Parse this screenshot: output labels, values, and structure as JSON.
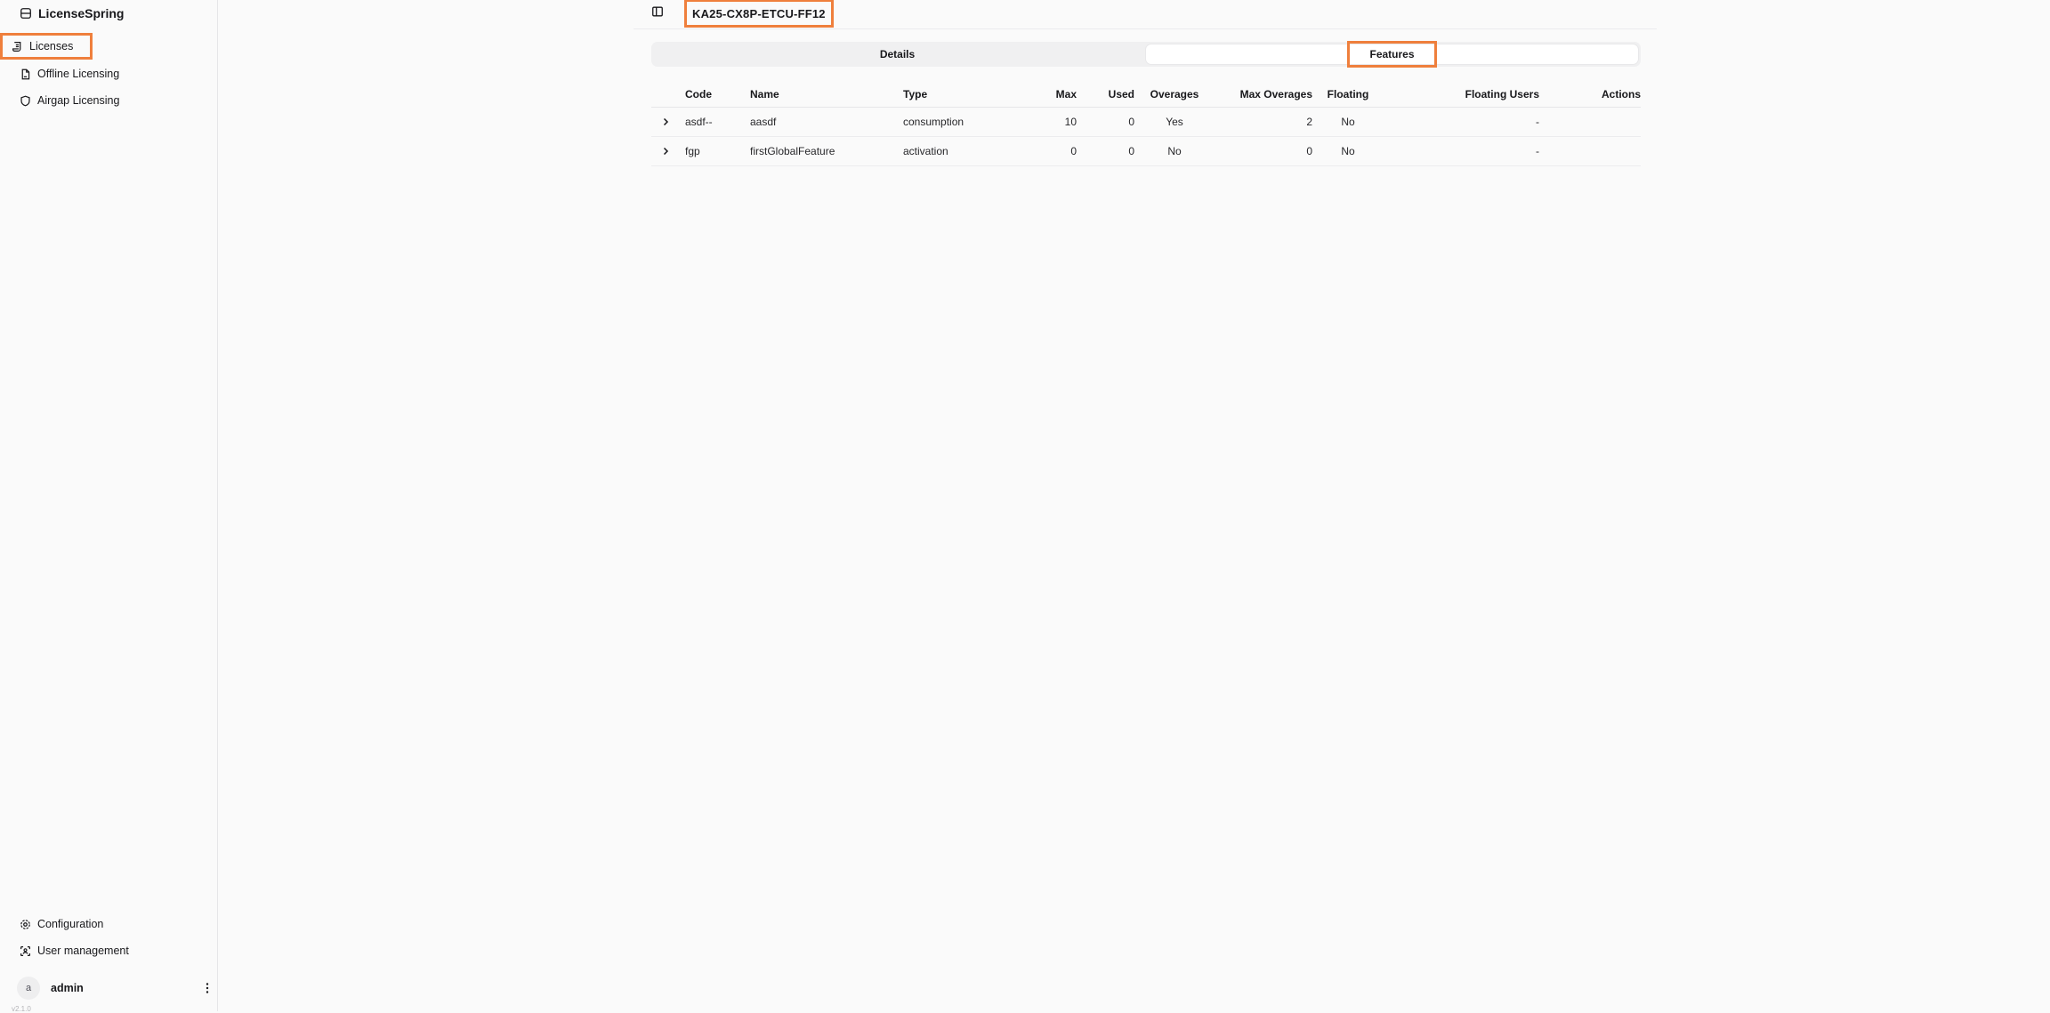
{
  "brand": {
    "name": "LicenseSpring"
  },
  "sidebar": {
    "items": [
      {
        "label": "Licenses"
      },
      {
        "label": "Offline Licensing"
      },
      {
        "label": "Airgap Licensing"
      }
    ],
    "bottom": [
      {
        "label": "Configuration"
      },
      {
        "label": "User management"
      }
    ],
    "user": {
      "avatar": "a",
      "name": "admin"
    },
    "version": "v2.1.0"
  },
  "header": {
    "license_key": "KA25-CX8P-ETCU-FF12"
  },
  "tabs": [
    {
      "label": "Details",
      "active": false
    },
    {
      "label": "Features",
      "active": true
    }
  ],
  "table": {
    "headers": [
      "Code",
      "Name",
      "Type",
      "Max",
      "Used",
      "Overages",
      "Max Overages",
      "Floating",
      "Floating Users",
      "Actions"
    ],
    "rows": [
      {
        "code": "asdf--",
        "name": "aasdf",
        "type": "consumption",
        "max": "10",
        "used": "0",
        "overages": "Yes",
        "max_overages": "2",
        "floating": "No",
        "floating_users": "-",
        "actions": ""
      },
      {
        "code": "fgp",
        "name": "firstGlobalFeature",
        "type": "activation",
        "max": "0",
        "used": "0",
        "overages": "No",
        "max_overages": "0",
        "floating": "No",
        "floating_users": "-",
        "actions": ""
      }
    ]
  },
  "colors": {
    "highlight": "#ef7f3c",
    "background": "#fafafa"
  }
}
